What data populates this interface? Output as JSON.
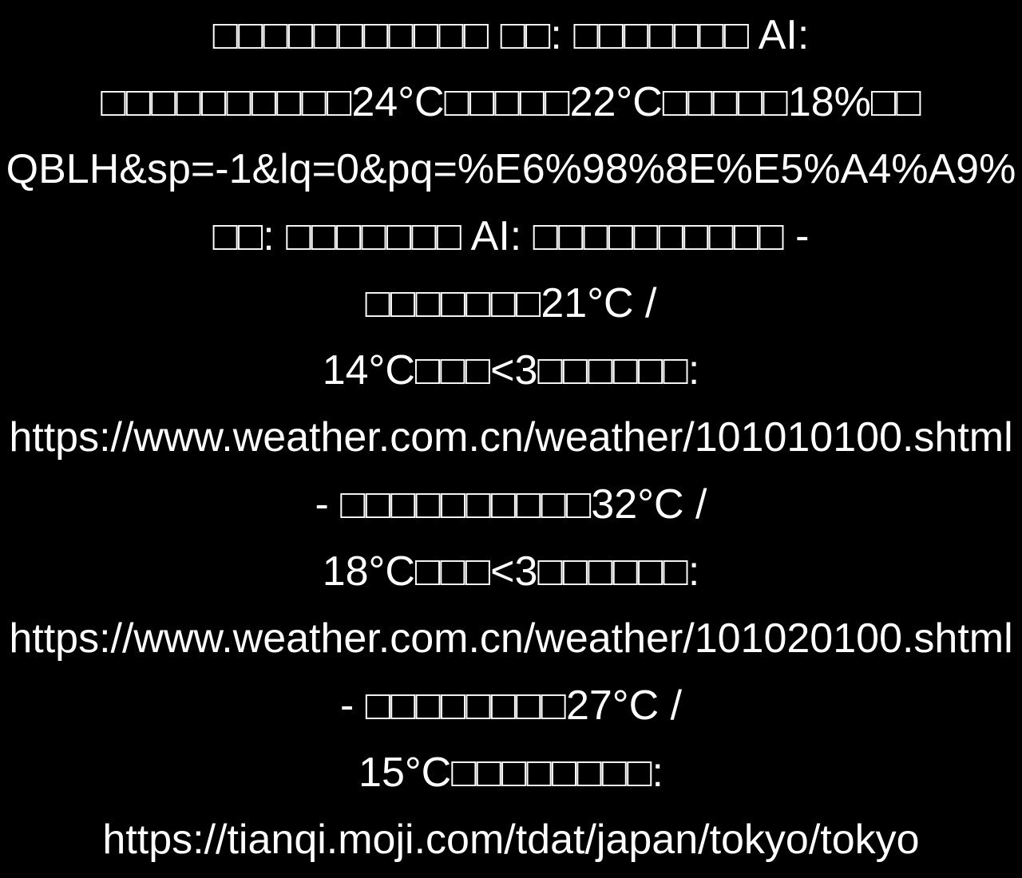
{
  "lines": [
    "□□□□□□□□□□□ □□: □□□□□□□ AI:",
    "□□□□□□□□□□24°C□□□□□22°C□□□□□18%□□",
    "QBLH&sp=-1&lq=0&pq=%E6%98%8E%E5%A4%A9%",
    "□□: □□□□□□□ AI: □□□□□□□□□□ -",
    "□□□□□□□21°C /",
    "14°C□□□<3□□□□□□:",
    "https://www.weather.com.cn/weather/101010100.shtml",
    "- □□□□□□□□□□32°C /",
    "18°C□□□<3□□□□□□:",
    "https://www.weather.com.cn/weather/101020100.shtml",
    "- □□□□□□□□27°C /",
    "15°C□□□□□□□□:",
    "https://tianqi.moji.com/tdat/japan/tokyo/tokyo"
  ],
  "colors": {
    "background": "#000000",
    "text": "#ffffff"
  }
}
